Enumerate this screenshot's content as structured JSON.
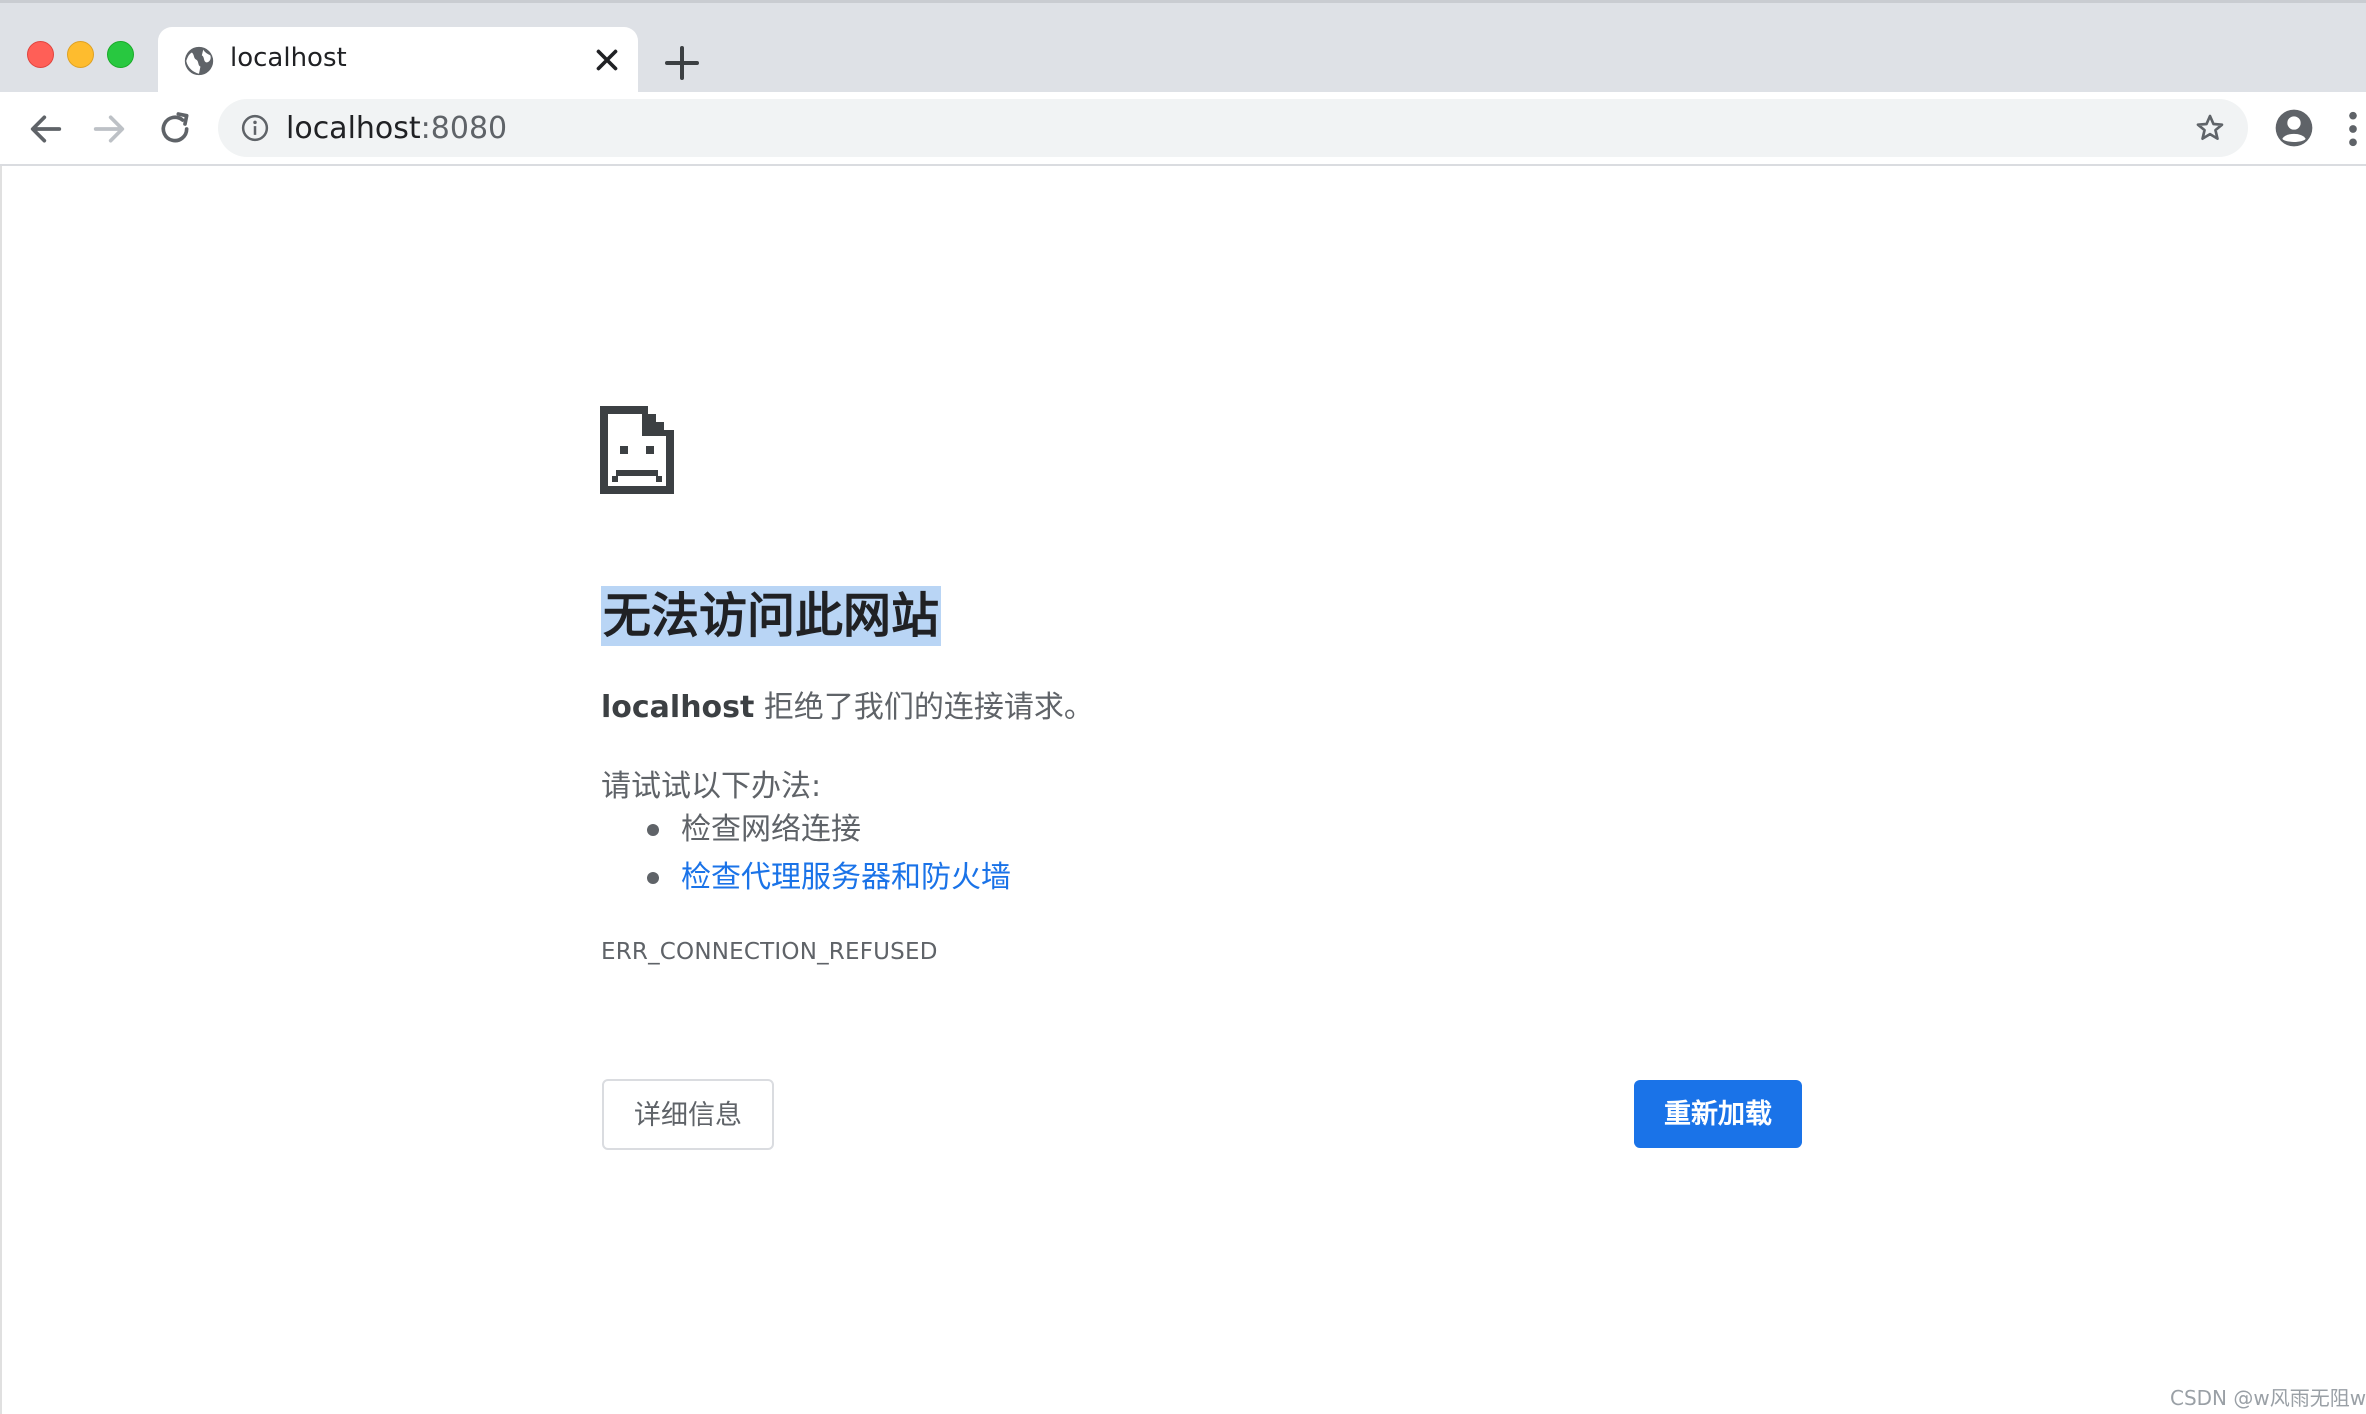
{
  "window": {
    "tab_title": "localhost",
    "new_tab_glyph": "+"
  },
  "toolbar": {
    "url_host": "localhost",
    "url_port": ":8080"
  },
  "error_page": {
    "heading": "无法访问此网站",
    "host": "localhost",
    "message": " 拒绝了我们的连接请求。",
    "try_title": "请试试以下办法:",
    "suggestions": [
      {
        "label": "检查网络连接",
        "link": false
      },
      {
        "label": "检查代理服务器和防火墙",
        "link": true
      }
    ],
    "error_code": "ERR_CONNECTION_REFUSED",
    "details_button": "详细信息",
    "reload_button": "重新加载"
  },
  "watermark": "CSDN @w风雨无阻w",
  "icons": {
    "tab_favicon": "globe-icon",
    "tab_close": "close-icon",
    "back": "arrow-left-icon",
    "forward": "arrow-right-icon",
    "reload": "reload-icon",
    "site_info": "info-icon",
    "bookmark": "star-icon",
    "profile": "account-icon",
    "menu": "more-vert-icon",
    "error": "sad-document-icon"
  },
  "colors": {
    "accent": "#1a73e8",
    "heading_highlight": "#b9d5f5",
    "tabstrip": "#dee1e6",
    "omnibox": "#f1f3f4"
  }
}
